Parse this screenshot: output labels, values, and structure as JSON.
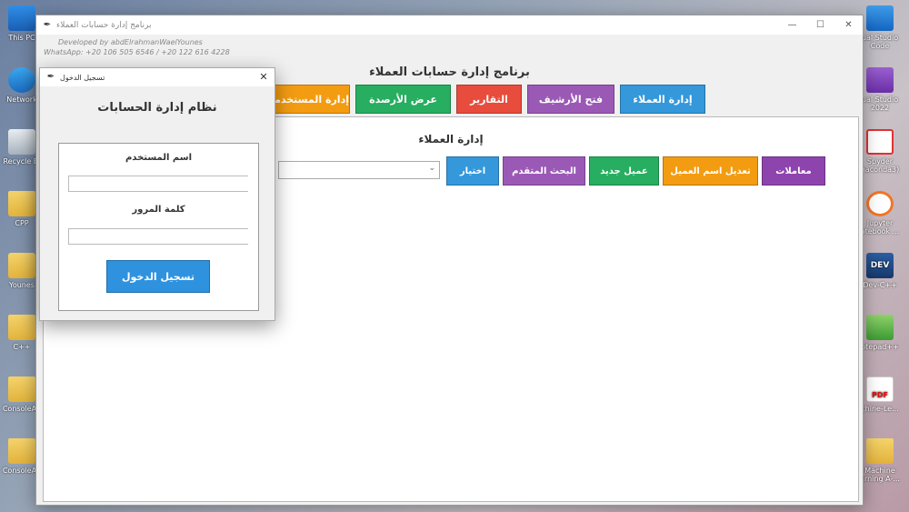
{
  "desktop": {
    "left_icons": [
      {
        "label": "This PC",
        "icon": "pc-icon"
      },
      {
        "label": "Network",
        "icon": "network-icon"
      },
      {
        "label": "Recycle Bi",
        "icon": "recycle-bin-icon"
      },
      {
        "label": "CPP",
        "icon": "folder-icon"
      },
      {
        "label": "Younes",
        "icon": "user-folder-icon"
      },
      {
        "label": "C++",
        "icon": "folder-icon"
      },
      {
        "label": "ConsoleAp",
        "icon": "folder-icon"
      },
      {
        "label": "ConsoleAp",
        "icon": "folder-icon"
      }
    ],
    "right_icons": [
      {
        "label": "ual Studio Code",
        "icon": "vscode-icon"
      },
      {
        "label": "ual Studio 2022",
        "icon": "visual-studio-icon"
      },
      {
        "label": "Spyder naconda3)",
        "icon": "spyder-icon"
      },
      {
        "label": "Jupyter otebook ...",
        "icon": "jupyter-icon"
      },
      {
        "label": "Dev-C++",
        "icon": "devcpp-icon"
      },
      {
        "label": "otepad++",
        "icon": "notepadpp-icon"
      },
      {
        "label": "chine-Le...",
        "icon": "pdf-icon"
      },
      {
        "label": "Machine arning A-...",
        "icon": "folder-icon"
      }
    ]
  },
  "main_window": {
    "title": "برنامج إدارة حسابات العملاء",
    "controls": {
      "minimize": "—",
      "maximize": "☐",
      "close": "✕"
    },
    "credit_line1": "Developed by abdElrahmanWaelYounes",
    "credit_line2": "WhatsApp: +20 106 505 6546 / +20 122 616 4228",
    "heading": "برنامج إدارة حسابات العملاء",
    "nav_buttons": [
      {
        "label": "إدارة العملاء",
        "color": "#3498db"
      },
      {
        "label": "فتح الأرشيف",
        "color": "#9b59b6"
      },
      {
        "label": "التقارير",
        "color": "#e74c3c"
      },
      {
        "label": "عرض الأرصدة",
        "color": "#27ae60"
      },
      {
        "label": "إدارة المستخدمين",
        "color": "#f39c12"
      }
    ],
    "panel": {
      "title": "إدارة العملاء",
      "select_value": "",
      "select_chevron": "⌄",
      "actions": [
        {
          "label": "اختيار",
          "color": "#3498db"
        },
        {
          "label": "البحث المتقدم",
          "color": "#9b59b6"
        },
        {
          "label": "عميل جديد",
          "color": "#27ae60"
        },
        {
          "label": "تعديل اسم العميل",
          "color": "#f39c12"
        },
        {
          "label": "معاملات",
          "color": "#8e44ad"
        }
      ]
    }
  },
  "login_dialog": {
    "title": "تسجيل الدخول",
    "close": "✕",
    "heading": "نظام إدارة الحسابات",
    "username_label": "اسم المستخدم",
    "username_value": "",
    "password_label": "كلمة المرور",
    "password_value": "",
    "submit_label": "تسجيل الدخول"
  }
}
